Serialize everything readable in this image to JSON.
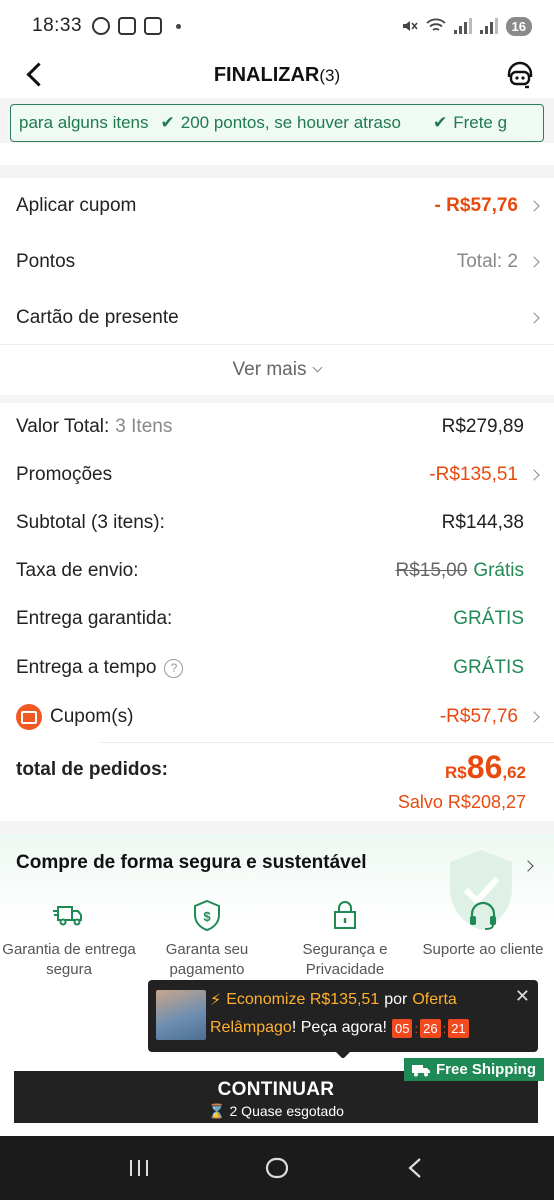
{
  "status_bar": {
    "time": "18:33",
    "battery": "16"
  },
  "header": {
    "title": "FINALIZAR",
    "count": "(3)"
  },
  "marquee": {
    "items": [
      "para alguns itens",
      "200 pontos, se houver atraso",
      "Frete g"
    ]
  },
  "options": {
    "coupon_label": "Aplicar cupom",
    "coupon_value": "- R$57,76",
    "points_label": "Pontos",
    "points_value": "Total: 2",
    "gift_card_label": "Cartão de presente",
    "see_more": "Ver mais"
  },
  "summary": {
    "total_value_label": "Valor Total:",
    "total_value_items": "3 Itens",
    "total_value": "R$279,89",
    "promotions_label": "Promoções",
    "promotions_value": "-R$135,51",
    "subtotal_label": "Subtotal (3 itens):",
    "subtotal_value": "R$144,38",
    "shipping_label": "Taxa de envio:",
    "shipping_old": "R$15,00",
    "shipping_value": "Grátis",
    "guaranteed_label": "Entrega garantida:",
    "guaranteed_value": "GRÁTIS",
    "ontime_label": "Entrega a tempo",
    "ontime_value": "GRÁTIS",
    "coupons_label": "Cupom(s)",
    "coupons_value": "-R$57,76",
    "order_total_label": "total de pedidos:",
    "order_total_currency": "R$",
    "order_total_int": "86",
    "order_total_cents": ",62",
    "saved": "Salvo R$208,27"
  },
  "security": {
    "title": "Compre de forma segura e sustentável",
    "features": [
      {
        "icon": "truck-icon",
        "label": "Garantia de entrega segura"
      },
      {
        "icon": "shield-dollar-icon",
        "label": "Garanta seu pagamento"
      },
      {
        "icon": "lock-icon",
        "label": "Segurança e Privacidade"
      },
      {
        "icon": "headset-icon",
        "label": "Suporte ao cliente"
      }
    ]
  },
  "promo": {
    "economize": "Economize R$135,51",
    "por": "por",
    "oferta": "Oferta",
    "relampago": "Relâmpago",
    "peca": "! Peça agora!",
    "timer_h": "05",
    "timer_m": "26",
    "timer_s": "21"
  },
  "bottom": {
    "free_shipping": "Free Shipping",
    "continue_label": "CONTINUAR",
    "continue_sub": "2 Quase esgotado"
  },
  "colors": {
    "accent": "#e84a0e",
    "green": "#1f8a55",
    "dark": "#222222"
  }
}
